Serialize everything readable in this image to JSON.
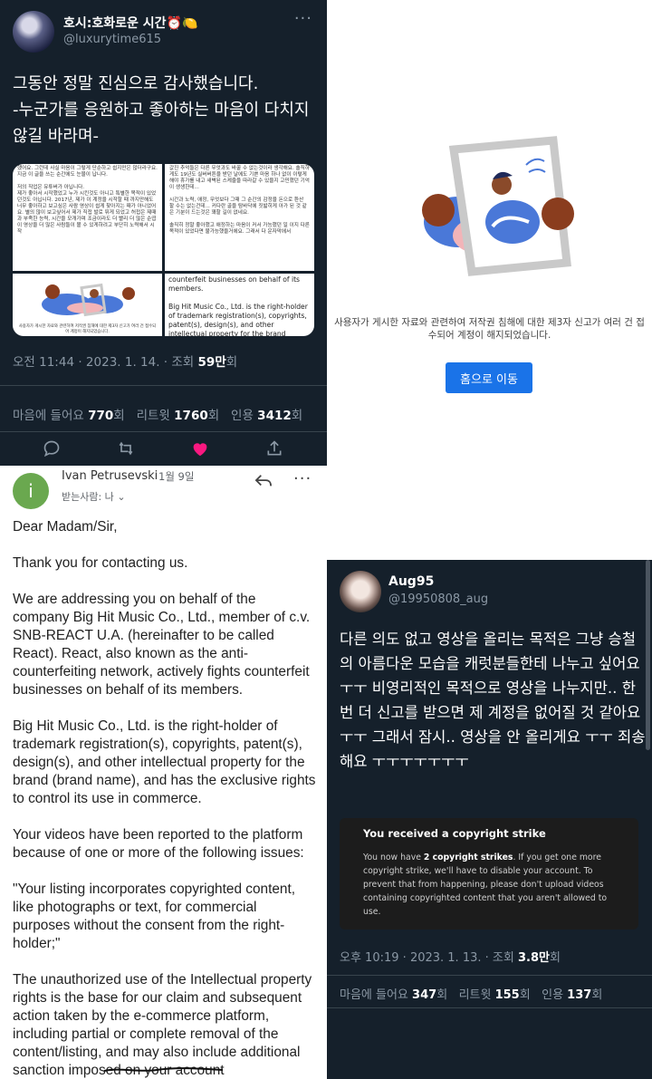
{
  "tweet1": {
    "display_name": "호시:호화로운 시간⏰🍋",
    "handle": "@luxurytime615",
    "text_line1": "그동안 정말 진심으로 감사했습니다.",
    "text_line2": "-누군가를 응원하고 좋아하는 마음이 다치지 않길 바라며-",
    "media": {
      "cell1_text": "했어요. 그런데 사실 마음이 그렇게 단순하고 쉽지만은 않더라구요. 지금 이 글을 쓰는 순간에도 눈물이 납니다.\n\n저의 직업은 유튜버가 아닙니다.\n제가 좋아서 시작했었고 누가 시킨것도 아니고 특별한 목적이 있었던것도 아닙니다. 2017년, 제가 이 계정을 시작할 때 까지만해도 너무 좋아하고 보고싶은 사람 영상이 쉽게 찾아지는 때가 아니었어요. 별의 많이 보고싶어서 제가 직접 발로 뛰게 되었고 허접은 제때과 부족한 능력, 시간을 모개가며 조금이라도 더 빨리 더 많은 순엽이 영상을 더 많은 사람들이 볼 수 있게하려고 부단히 노력해서 시작",
      "cell2_text": "값진 추억들은 다른 무엇과도 바꿀 수 없는것이라 생각해요. 솔직하게도 19년도 실버버튼을 받던 날에도 기쁜 마음 하나 없이 이렇게해야 휴가를 내고 새벽된 스케줄을 따라갈 수 있을지 고민했던 기억이 생생한데...\n\n시간과 노력, 애정, 무엇보다 그때 그 순간의 감정을 돈으로 환산 할 수는 없는건데... 커다란 골을 탐바닥에 짓밟히게 아가 된 것 같은 기분이 드는것은 꽤할 길이 없네요.\n\n솔직히 정말 좋아했고 애정하는 마음이 커서 가능했던 일 이지 다른 목적이 있었다면 불가능했을거에요. 그래서 다 운자막에서",
      "cell3_caption": "사용자가 게시한 자료와 관련하여 저작권 침해에 대한 제3자 신고가 여러 건 접수되어 계정이 해지되었습니다.",
      "cell4_text": "counterfeit businesses on behalf of its members.\n\nBig Hit Music Co., Ltd. is the right-holder of trademark registration(s), copyrights, patent(s), design(s), and other intellectual property for the brand (brand name), and has the exclusive rights to control its use in commerce.\n\nYour videos have been reported to the platform because of one or more of the following issues:"
    },
    "time": "오전 11:44",
    "date": "2023. 1. 14.",
    "views_label": "조회",
    "views": "59만",
    "views_unit": "회",
    "likes_label": "마음에 들어요",
    "likes": "770",
    "retweets_label": "리트윗",
    "retweets": "1760",
    "quotes_label": "인용",
    "quotes": "3412",
    "count_unit": "회"
  },
  "notice": {
    "message": "사용자가 게시한 자료와 관련하여 저작권 침해에 대한 제3자 신고가 여러 건 접수되어 계정이 해지되었습니다.",
    "button": "홈으로 이동"
  },
  "email": {
    "avatar_letter": "i",
    "sender": "Ivan Petrusevski",
    "date": "1월 9일",
    "recipient": "받는사람: 나",
    "greeting": "Dear Madam/Sir,",
    "p1": "Thank you for contacting us.",
    "p2": "We are addressing you on behalf of the company Big Hit Music Co., Ltd., member of c.v. SNB-REACT U.A. (hereinafter to be called React). React, also known as the anti-counterfeiting network, actively fights counterfeit businesses on behalf of its members.",
    "p3": "Big Hit Music Co., Ltd. is the right-holder of trademark registration(s), copyrights, patent(s), design(s), and other intellectual property for the brand (brand name), and has the exclusive rights to control its use in commerce.",
    "p4": "Your videos have been reported to the platform because of one or more of the following issues:",
    "p5": "\"Your listing incorporates copyrighted content, like photographs or text, for commercial purposes without the consent from the right-holder;\"",
    "p6": "The unauthorized use of the Intellectual property rights is the base for our claim and subsequent action taken by the e-commerce platform, including partial or complete removal of the content/listing, and may also include additional sanction imposed on your account"
  },
  "tweet2": {
    "display_name": "Aug95",
    "handle": "@19950808_aug",
    "text": "다른 의도 없고 영상을 올리는 목적은 그냥 승철의 아름다운 모습을 캐럿분들한테 나누고 싶어요 ㅜㅜ 비영리적인 목적으로 영상을 나누지만.. 한번 더 신고를 받으면 제 계정을 없어질 것 같아요 ㅜㅜ 그래서  잠시..  영상을 안 올리게요 ㅜㅜ 죄송해요 ㅜㅜㅜㅜㅜㅜㅜ",
    "strike_title": "You received a copyright strike",
    "strike_body_pre": "You now have ",
    "strike_body_bold": "2 copyright strikes",
    "strike_body_post": ". If you get one more copyright strike, we'll have to disable your account. To prevent that from happening, please don't upload videos containing copyrighted content that you aren't allowed to use.",
    "time": "오후 10:19",
    "date": "2023. 1. 13.",
    "views_label": "조회",
    "views": "3.8만",
    "views_unit": "회",
    "likes_label": "마음에 들어요",
    "likes": "347",
    "retweets_label": "리트윗",
    "retweets": "155",
    "quotes_label": "인용",
    "quotes": "137",
    "count_unit": "회"
  }
}
